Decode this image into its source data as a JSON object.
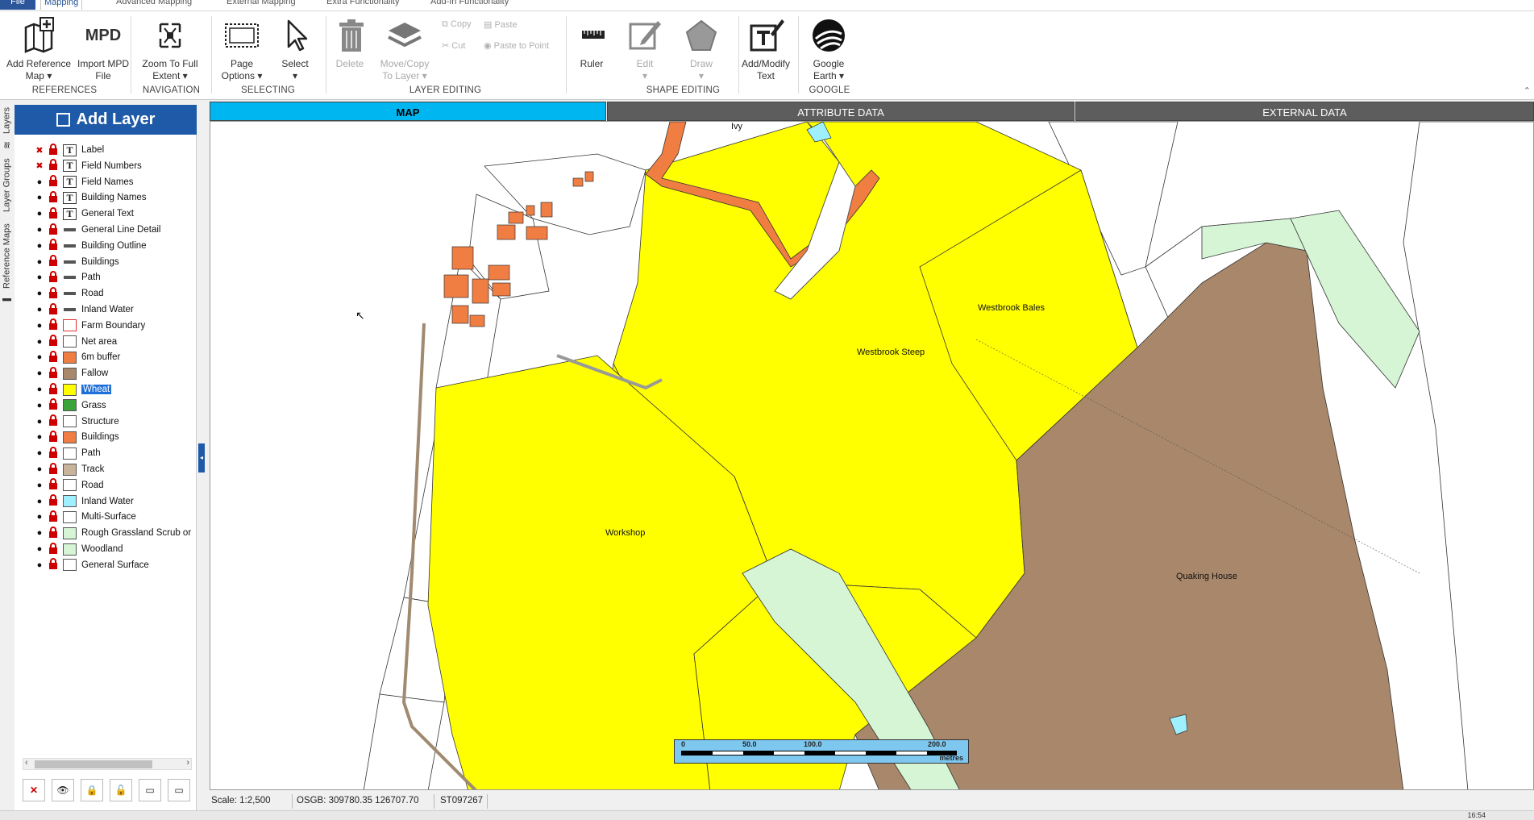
{
  "tabs": [
    "File",
    "Mapping",
    "Advanced Mapping",
    "External Mapping",
    "Extra Functionality",
    "Add-In Functionality"
  ],
  "ribbon": {
    "add_reference_map": "Add Reference Map",
    "import_mpd": "Import MPD File",
    "mpd_text": "MPD",
    "zoom_extent": "Zoom To Full Extent",
    "page_options": "Page Options",
    "select": "Select",
    "delete": "Delete",
    "move_copy": "Move/Copy To Layer",
    "copy": "Copy",
    "paste": "Paste",
    "cut": "Cut",
    "paste_to_point": "Paste to Point",
    "ruler": "Ruler",
    "edit": "Edit",
    "draw": "Draw",
    "add_modify_text": "Add/Modify Text",
    "google_earth": "Google Earth",
    "groups": {
      "references": "REFERENCES",
      "navigation": "NAVIGATION",
      "selecting": "SELECTING",
      "layer_editing": "LAYER EDITING",
      "shape_editing": "SHAPE EDITING",
      "google": "GOOGLE"
    }
  },
  "side_tabs": [
    "Layers",
    "Layer Groups",
    "Reference Maps"
  ],
  "layer_panel": {
    "add_layer": "Add Layer",
    "layers": [
      {
        "name": "Label",
        "sym": "text",
        "hidden": true
      },
      {
        "name": "Field Numbers",
        "sym": "text",
        "hidden": true
      },
      {
        "name": "Field Names",
        "sym": "text"
      },
      {
        "name": "Building Names",
        "sym": "text"
      },
      {
        "name": "General Text",
        "sym": "text"
      },
      {
        "name": "General Line Detail",
        "sym": "line"
      },
      {
        "name": "Building Outline",
        "sym": "line"
      },
      {
        "name": "Buildings",
        "sym": "line"
      },
      {
        "name": "Path",
        "sym": "line"
      },
      {
        "name": "Road",
        "sym": "line"
      },
      {
        "name": "Inland Water",
        "sym": "line",
        "color": "#2e6d9e"
      },
      {
        "name": "Farm Boundary",
        "sym": "fill",
        "color": "#ffffff",
        "border": "#e03030"
      },
      {
        "name": "Net area",
        "sym": "fill",
        "color": "#ffffff"
      },
      {
        "name": "6m buffer",
        "sym": "fill",
        "color": "#f07d42"
      },
      {
        "name": "Fallow",
        "sym": "fill",
        "color": "#a9876a"
      },
      {
        "name": "Wheat",
        "sym": "fill",
        "color": "#ffff00",
        "selected": true
      },
      {
        "name": "Grass",
        "sym": "fill",
        "color": "#3aa33a"
      },
      {
        "name": "Structure",
        "sym": "fill",
        "color": "#ffffff"
      },
      {
        "name": "Buildings",
        "sym": "fill",
        "color": "#f07d42"
      },
      {
        "name": "Path",
        "sym": "fill",
        "color": "#ffffff"
      },
      {
        "name": "Track",
        "sym": "fill",
        "color": "#c8b49a"
      },
      {
        "name": "Road",
        "sym": "fill",
        "color": "#ffffff"
      },
      {
        "name": "Inland Water",
        "sym": "fill",
        "color": "#9ff0ff"
      },
      {
        "name": "Multi-Surface",
        "sym": "fill",
        "color": "#ffffff"
      },
      {
        "name": "Rough Grassland  Scrub or",
        "sym": "fill",
        "color": "#d5f5d5"
      },
      {
        "name": "Woodland",
        "sym": "fill",
        "color": "#d5f5d5"
      },
      {
        "name": "General Surface",
        "sym": "fill",
        "color": "#ffffff"
      }
    ]
  },
  "view_tabs": [
    "MAP",
    "ATTRIBUTE DATA",
    "EXTERNAL DATA"
  ],
  "map": {
    "labels": {
      "ivy": "Ivy",
      "westbrook_bales": "Westbrook Bales",
      "westbrook_steep": "Westbrook Steep",
      "workshop": "Workshop",
      "quaking_house": "Quaking House"
    },
    "scale_bar": {
      "ticks": [
        "0",
        "50.0",
        "100.0",
        "200.0"
      ],
      "unit": "metres"
    },
    "colors": {
      "wheat": "#ffff00",
      "fallow": "#a9876a",
      "grass": "#d5f5d5",
      "buffer": "#f07d42"
    }
  },
  "status": {
    "scale": "Scale: 1:2,500",
    "coords": "OSGB: 309780.35  126707.70",
    "grid": "ST097267"
  },
  "clock": "16:54"
}
